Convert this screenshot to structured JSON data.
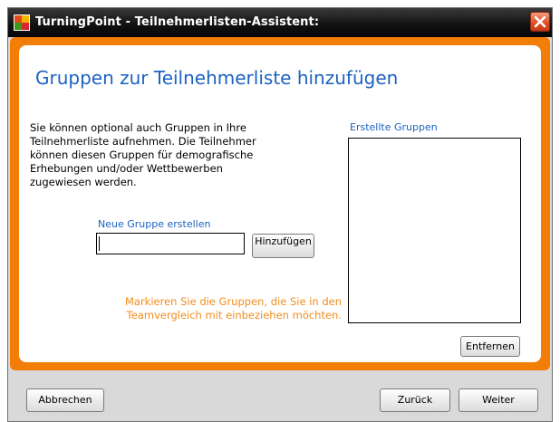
{
  "window": {
    "title": "TurningPoint - Teilnehmerlisten-Assistent:",
    "close_icon": "close-icon",
    "app_icon": "turningpoint-logo-icon"
  },
  "main": {
    "heading": "Gruppen zur Teilnehmerliste hinzufügen",
    "description": "Sie können optional auch Gruppen in Ihre\nTeilnehmerliste aufnehmen. Die Teilnehmer\nkönnen diesen Gruppen für demografische\nErhebungen und/oder Wettbewerben\nzugewiesen werden.",
    "new_group_label": "Neue Gruppe erstellen",
    "new_group_value": "",
    "add_button": "Hinzufügen",
    "created_groups_label": "Erstellte Gruppen",
    "created_groups": [],
    "remove_button": "Entfernen",
    "hint": "Markieren Sie die Gruppen, die Sie in den\nTeamvergleich mit einbeziehen möchten."
  },
  "footer": {
    "cancel": "Abbrechen",
    "back": "Zurück",
    "next": "Weiter"
  },
  "colors": {
    "accent_orange": "#f27e08",
    "heading_blue": "#1c62c0",
    "hint_orange": "#f28c1c",
    "titlebar": "#121212"
  }
}
